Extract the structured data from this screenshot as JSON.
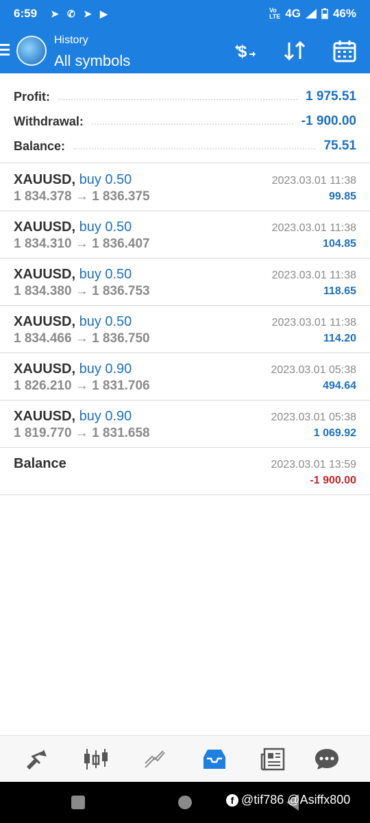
{
  "status_bar": {
    "time": "6:59",
    "network": "4G",
    "battery": "46%"
  },
  "header": {
    "subtitle": "History",
    "title": "All symbols",
    "icons": [
      "menu-icon",
      "exchange-dollar-icon",
      "sort-icon",
      "calendar-icon"
    ]
  },
  "summary": {
    "profit_label": "Profit:",
    "profit_value": "1 975.51",
    "withdrawal_label": "Withdrawal:",
    "withdrawal_value": "-1 900.00",
    "balance_label": "Balance:",
    "balance_value": "75.51"
  },
  "deals": [
    {
      "symbol": "XAUUSD,",
      "type": "buy 0.50",
      "price": "1 834.378 → 1 836.375",
      "time": "2023.03.01 11:38",
      "profit": "99.85"
    },
    {
      "symbol": "XAUUSD,",
      "type": "buy 0.50",
      "price": "1 834.310 → 1 836.407",
      "time": "2023.03.01 11:38",
      "profit": "104.85"
    },
    {
      "symbol": "XAUUSD,",
      "type": "buy 0.50",
      "price": "1 834.380 → 1 836.753",
      "time": "2023.03.01 11:38",
      "profit": "118.65"
    },
    {
      "symbol": "XAUUSD,",
      "type": "buy 0.50",
      "price": "1 834.466 → 1 836.750",
      "time": "2023.03.01 11:38",
      "profit": "114.20"
    },
    {
      "symbol": "XAUUSD,",
      "type": "buy 0.90",
      "price": "1 826.210 → 1 831.706",
      "time": "2023.03.01 05:38",
      "profit": "494.64"
    },
    {
      "symbol": "XAUUSD,",
      "type": "buy 0.90",
      "price": "1 819.770 → 1 831.658",
      "time": "2023.03.01 05:38",
      "profit": "1 069.92"
    }
  ],
  "balance_op": {
    "label": "Balance",
    "time": "2023.03.01 13:59",
    "amount": "-1 900.00"
  },
  "bottom_nav": [
    "quotes-icon",
    "chart-icon",
    "trade-icon",
    "history-icon",
    "news-icon",
    "messages-icon"
  ],
  "colors": {
    "accent": "#1d7fe0",
    "positive": "#1d6fc1",
    "negative": "#c0262d"
  },
  "watermark": "@tif786 @Asiffx800"
}
